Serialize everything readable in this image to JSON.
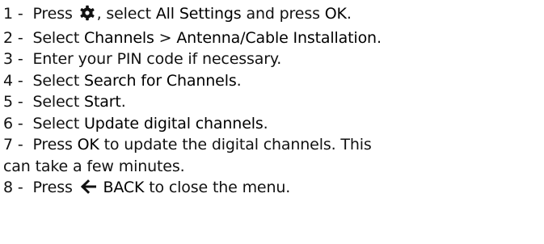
{
  "steps": [
    {
      "num": "1 -",
      "t1": "Press",
      "t2": ", select",
      "b1": "All Settings",
      "t3": "and press",
      "b2": "OK",
      "t4": "."
    },
    {
      "num": "2 -",
      "t1": "Select",
      "b1": "Channels",
      "t2": ">",
      "b2": "Antenna/Cable Installation",
      "t3": "."
    },
    {
      "num": "3 -",
      "t1": "Enter your PIN code if necessary."
    },
    {
      "num": "4 -",
      "t1": "Select",
      "b1": "Search for Channels",
      "t2": "."
    },
    {
      "num": "5 -",
      "t1": "Select",
      "b1": "Start",
      "t2": "."
    },
    {
      "num": "6 -",
      "t1": "Select",
      "b1": "Update digital channels",
      "t2": "."
    },
    {
      "num": "7 -",
      "t1": "Press",
      "b1": "OK",
      "t2": "to update the digital channels. This"
    },
    {
      "t1": "can take a few minutes."
    },
    {
      "num": "8 -",
      "t1": "Press",
      "b1": "BACK",
      "t2": "to close the menu."
    }
  ],
  "icons": {
    "settings": "gear-icon",
    "back": "left-arrow-icon"
  }
}
